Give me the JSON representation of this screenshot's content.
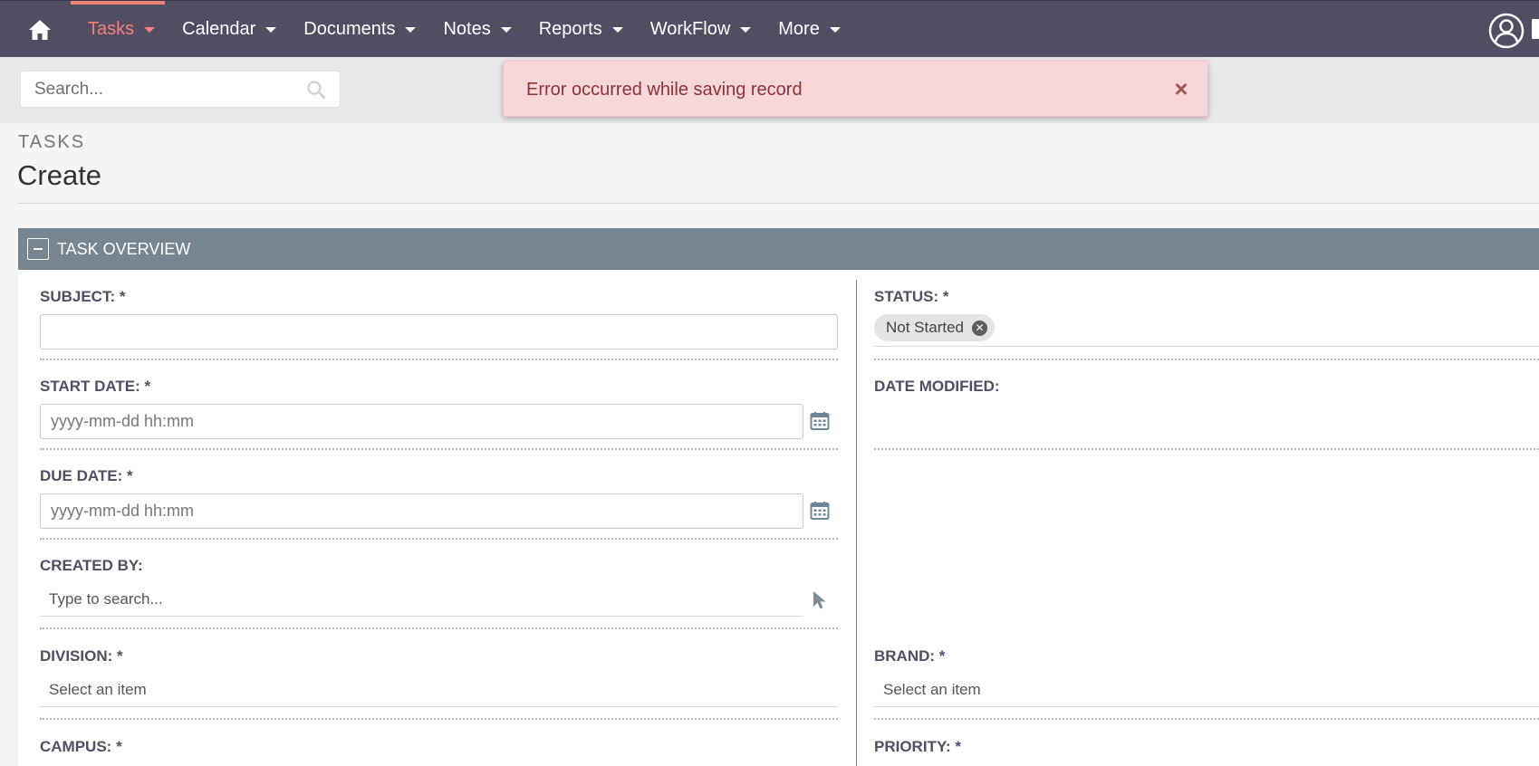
{
  "nav": {
    "items": [
      {
        "label": "Tasks",
        "active": true
      },
      {
        "label": "Calendar",
        "active": false
      },
      {
        "label": "Documents",
        "active": false
      },
      {
        "label": "Notes",
        "active": false
      },
      {
        "label": "Reports",
        "active": false
      },
      {
        "label": "WorkFlow",
        "active": false
      },
      {
        "label": "More",
        "active": false
      }
    ],
    "icons": {
      "home": "home-icon",
      "user": "user-circle-icon"
    },
    "colors": {
      "bar": "#534d64",
      "active": "#f08377"
    }
  },
  "search": {
    "placeholder": "Search..."
  },
  "toast": {
    "message": "Error occurred while saving record",
    "close": "×",
    "color": "#f8d7da"
  },
  "header": {
    "module": "TASKS",
    "title": "Create"
  },
  "panel": {
    "title": "TASK OVERVIEW",
    "color": "#778591"
  },
  "fields": {
    "subject": {
      "label": "SUBJECT:",
      "required": "*",
      "value": ""
    },
    "start_date": {
      "label": "START DATE:",
      "required": "*",
      "placeholder": "yyyy-mm-dd hh:mm"
    },
    "due_date": {
      "label": "DUE DATE:",
      "required": "*",
      "placeholder": "yyyy-mm-dd hh:mm"
    },
    "created_by": {
      "label": "CREATED BY:",
      "placeholder": "Type to search..."
    },
    "division": {
      "label": "DIVISION:",
      "required": "*",
      "placeholder": "Select an item"
    },
    "campus": {
      "label": "CAMPUS:",
      "required": "*"
    },
    "status": {
      "label": "STATUS:",
      "required": "*",
      "value": "Not Started",
      "remove": "✕"
    },
    "date_modified": {
      "label": "DATE MODIFIED:"
    },
    "brand": {
      "label": "BRAND:",
      "required": "*",
      "placeholder": "Select an item"
    },
    "priority": {
      "label": "PRIORITY:",
      "required": "*"
    }
  }
}
